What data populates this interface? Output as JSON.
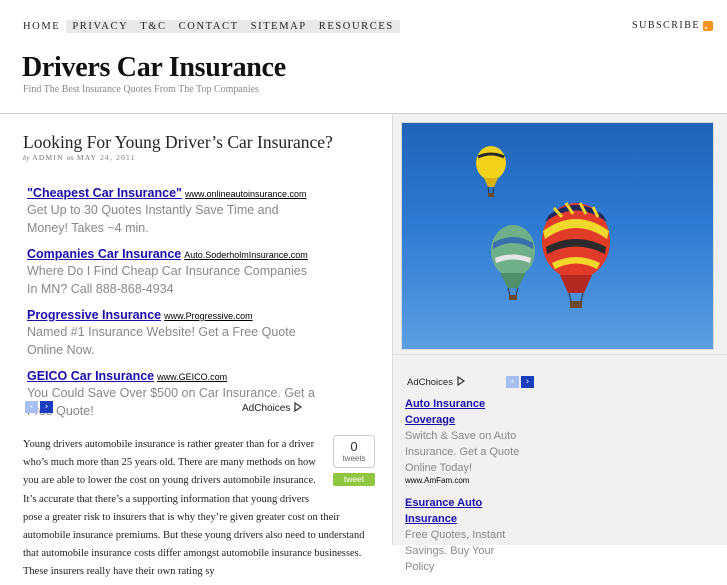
{
  "nav": {
    "items": [
      "HOME",
      "PRIVACY",
      "T&C",
      "CONTACT",
      "SITEMAP",
      "RESOURCES"
    ],
    "subscribe": "SUBSCRIBE"
  },
  "site": {
    "title": "Drivers Car Insurance",
    "tagline": "Find The Best Insurance Quotes From The Top Companies"
  },
  "post": {
    "title": "Looking For Young Driver’s Car Insurance?",
    "by": "by",
    "author": "ADMIN",
    "on": "on",
    "date": "MAY 24, 2011",
    "body": "Young drivers automobile insurance is rather greater than for a driver who’s much more than 25 years old. There are many methods on how you are able to lower the cost on young drivers automobile insurance. It’s accurate that there’s a supporting information that young drivers pose a greater risk to insurers that is why they’re given greater cost on their automobile insurance premiums. But these young drivers also need to understand that automobile insurance costs differ amongst automobile insurance businesses. These insurers really have their own rating sy"
  },
  "ads": [
    {
      "headline": "\"Cheapest Car Insurance\"",
      "url": "www.onlineautoinsurance.com",
      "desc": "Get Up to 30 Quotes Instantly Save Time and Money! Takes ~4 min."
    },
    {
      "headline": "Companies Car Insurance",
      "url": "Auto.SoderholmInsurance.com",
      "desc": "Where Do I Find Cheap Car Insurance Companies In MN? Call 888-868-4934"
    },
    {
      "headline": "Progressive Insurance",
      "url": "www.Progressive.com",
      "desc": "Named #1 Insurance Website! Get a Free Quote Online Now."
    },
    {
      "headline": "GEICO Car Insurance",
      "url": "www.GEICO.com",
      "desc": "You Could Save Over $500 on Car Insurance. Get a Free Quote!"
    }
  ],
  "adchoices": "AdChoices",
  "pager": {
    "prev": "‹",
    "next": "›"
  },
  "tweet": {
    "count": "0",
    "label": "tweets",
    "button": "tweet"
  },
  "sidebar": {
    "adchoices": "AdChoices",
    "ads": [
      {
        "headline": "Auto Insurance Coverage",
        "desc": "Switch & Save on Auto Insurance. Get a Quote Online Today!",
        "url": "www.AmFam.com"
      },
      {
        "headline": "Esurance Auto Insurance",
        "desc": "Free Quotes, Instant Savings. Buy Your Policy"
      }
    ]
  },
  "colors": {
    "ad_link": "#1a0dab",
    "tweet_green": "#8ec63f",
    "sky": "#2f7ad2"
  },
  "icons": [
    "rss-icon",
    "adchoices-icon",
    "prev-arrow-icon",
    "next-arrow-icon"
  ]
}
